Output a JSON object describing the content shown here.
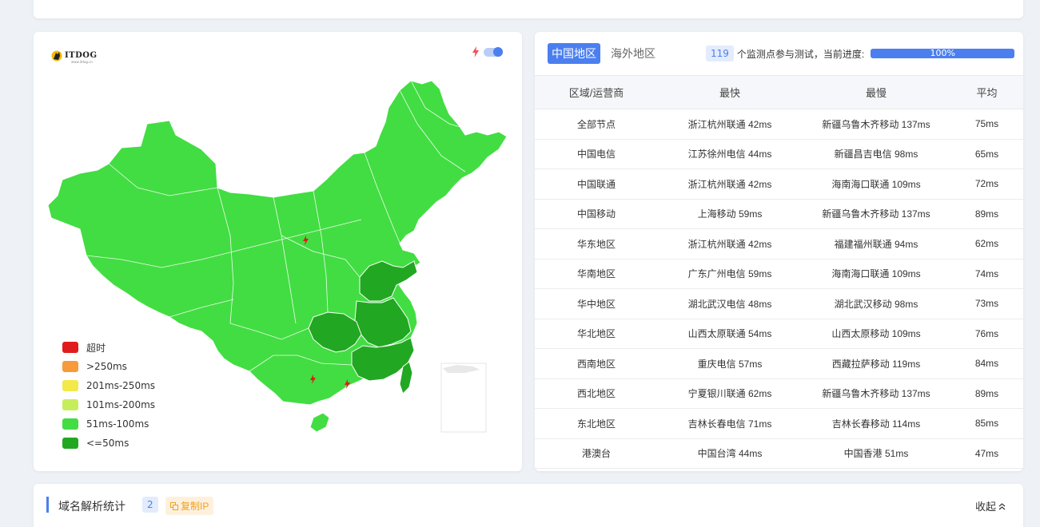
{
  "logo": {
    "text": "ITDOG",
    "sub": "www.itdog.cn"
  },
  "map": {
    "legend": [
      {
        "label": "超时",
        "color": "#e01b1b"
      },
      {
        "label": ">250ms",
        "color": "#f79a3b"
      },
      {
        "label": "201ms-250ms",
        "color": "#f4e94a"
      },
      {
        "label": "101ms-200ms",
        "color": "#c6ee5c"
      },
      {
        "label": "51ms-100ms",
        "color": "#42dd42"
      },
      {
        "label": "<=50ms",
        "color": "#22a722"
      }
    ]
  },
  "tabs": {
    "domestic": "中国地区",
    "overseas": "海外地区"
  },
  "progress": {
    "count": "119",
    "label": "个监测点参与测试，当前进度:",
    "percent": "100%",
    "value": 100
  },
  "table": {
    "headers": [
      "区域/运营商",
      "最快",
      "最慢",
      "平均"
    ],
    "rows": [
      [
        "全部节点",
        "浙江杭州联通 42ms",
        "新疆乌鲁木齐移动 137ms",
        "75ms"
      ],
      [
        "中国电信",
        "江苏徐州电信 44ms",
        "新疆昌吉电信 98ms",
        "65ms"
      ],
      [
        "中国联通",
        "浙江杭州联通 42ms",
        "海南海口联通 109ms",
        "72ms"
      ],
      [
        "中国移动",
        "上海移动 59ms",
        "新疆乌鲁木齐移动 137ms",
        "89ms"
      ],
      [
        "华东地区",
        "浙江杭州联通 42ms",
        "福建福州联通 94ms",
        "62ms"
      ],
      [
        "华南地区",
        "广东广州电信 59ms",
        "海南海口联通 109ms",
        "74ms"
      ],
      [
        "华中地区",
        "湖北武汉电信 48ms",
        "湖北武汉移动 98ms",
        "73ms"
      ],
      [
        "华北地区",
        "山西太原联通 54ms",
        "山西太原移动 109ms",
        "76ms"
      ],
      [
        "西南地区",
        "重庆电信 57ms",
        "西藏拉萨移动 119ms",
        "84ms"
      ],
      [
        "西北地区",
        "宁夏银川联通 62ms",
        "新疆乌鲁木齐移动 137ms",
        "89ms"
      ],
      [
        "东北地区",
        "吉林长春电信 71ms",
        "吉林长春移动 114ms",
        "85ms"
      ],
      [
        "港澳台",
        "中国台湾 44ms",
        "中国香港 51ms",
        "47ms"
      ]
    ]
  },
  "dns": {
    "title": "域名解析统计",
    "count": "2",
    "copy_label": "复制IP",
    "collapse_label": "收起"
  },
  "colors": {
    "accent": "#4b7ff0",
    "map_default": "#42dd42",
    "map_fast": "#22a722"
  }
}
